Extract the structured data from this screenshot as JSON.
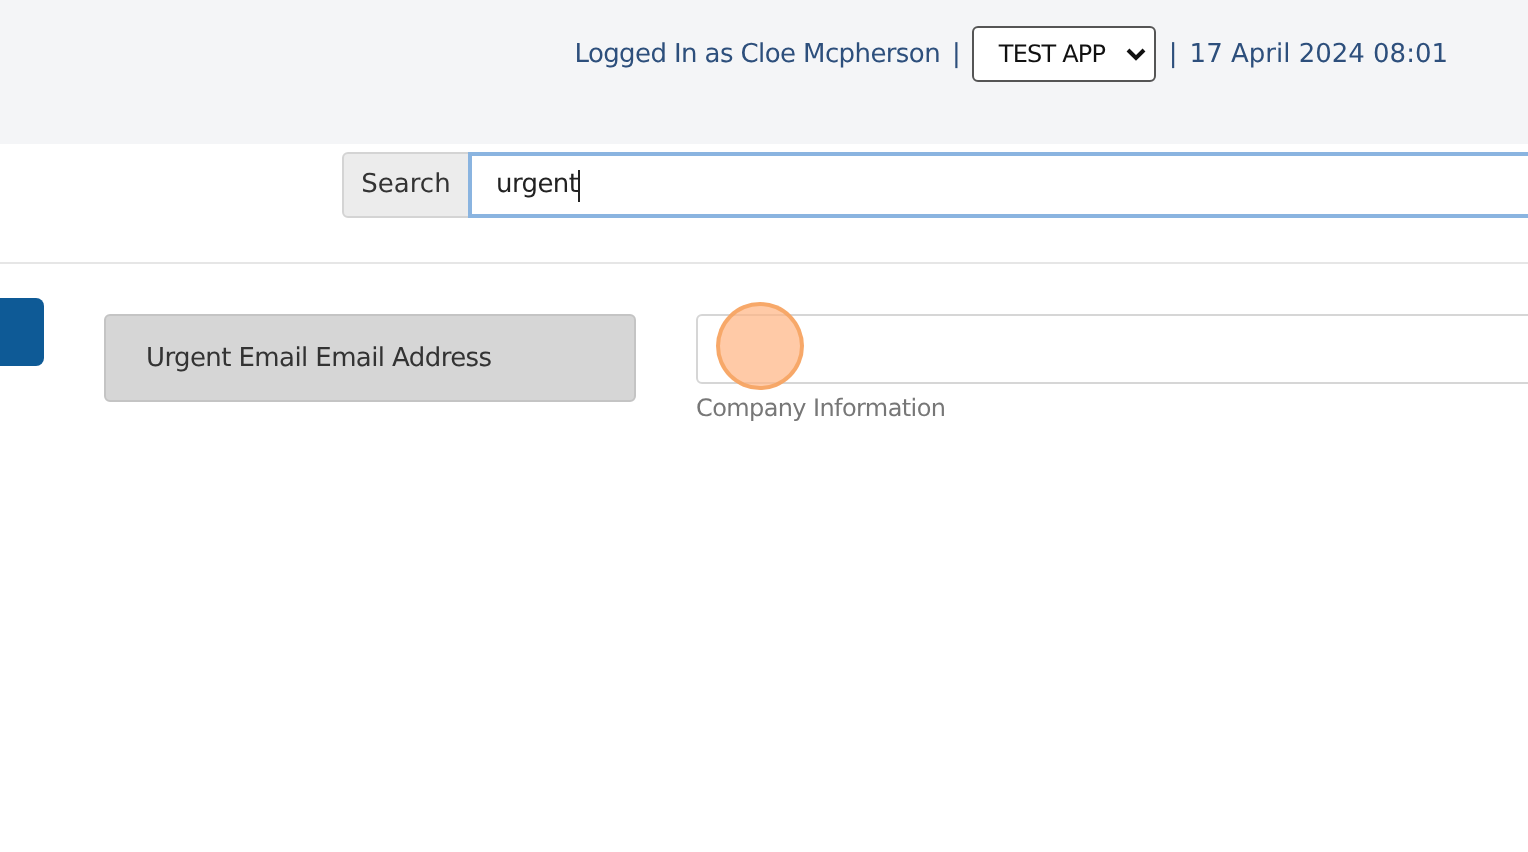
{
  "header": {
    "user": "Logged In as Cloe Mcpherson",
    "separator_1": "|",
    "app_select": "TEST APP",
    "separator_2": "|",
    "datetime": "17 April 2024 08:01"
  },
  "search": {
    "button": "Search",
    "value": "urgent"
  },
  "result": {
    "label": "Urgent Email Email Address",
    "caption": "Company Information"
  }
}
